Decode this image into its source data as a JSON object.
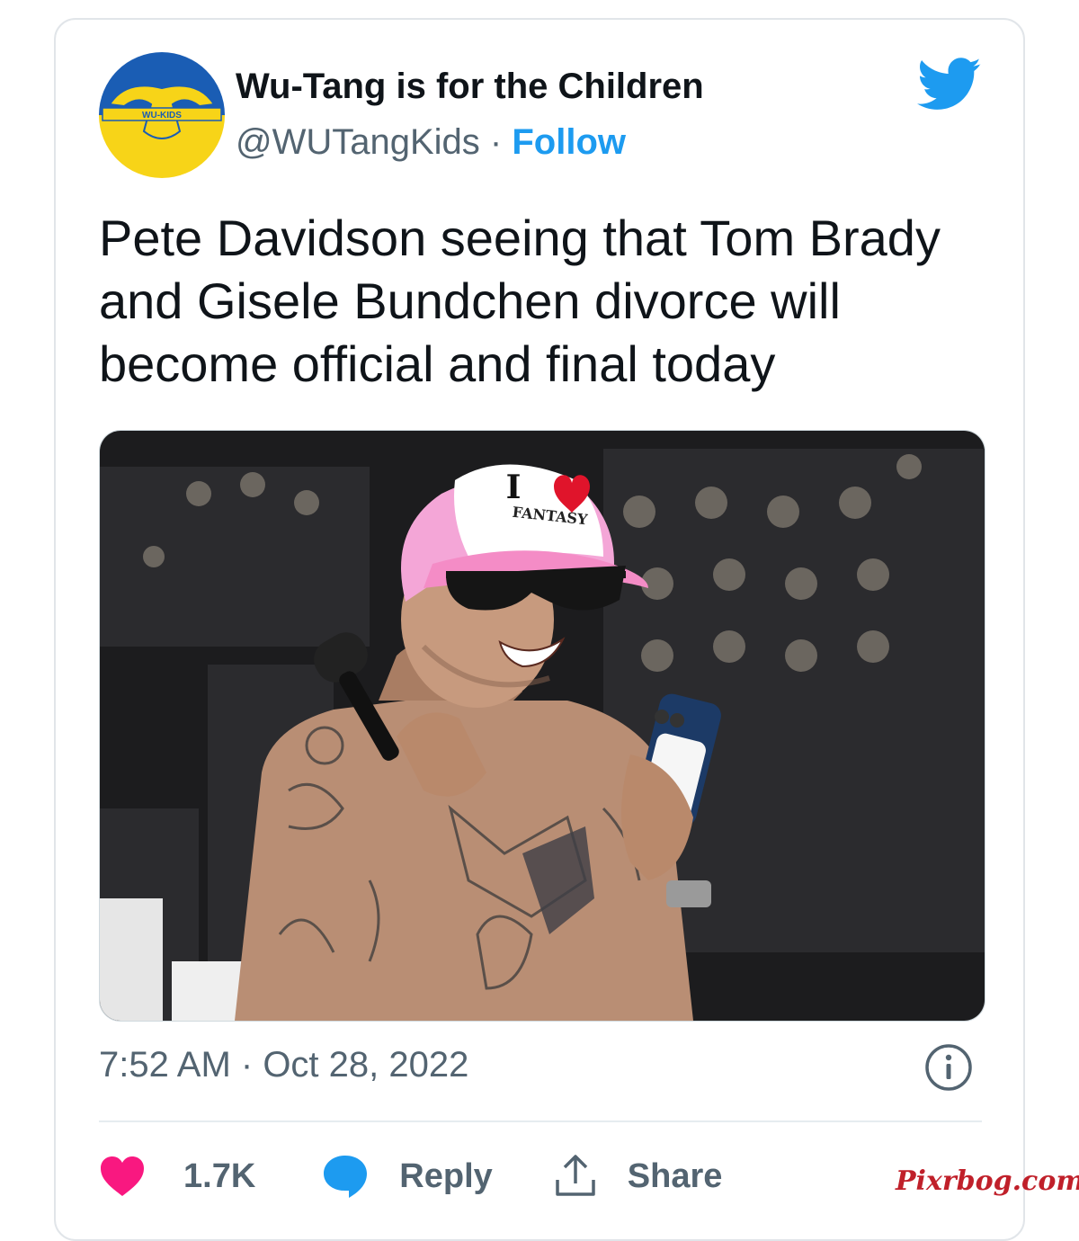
{
  "tweet": {
    "display_name": "Wu-Tang is for the Children",
    "handle": "@WUTangKids",
    "separator": " · ",
    "follow_label": "Follow",
    "text": "Pete Davidson seeing that Tom Brady and Gisele Bundchen divorce will become official and final today",
    "time": "7:52 AM",
    "date": "Oct 28, 2022",
    "likes": "1.7K",
    "reply_label": "Reply",
    "share_label": "Share",
    "avatar_logo_text": "WU-KIDS"
  },
  "media": {
    "cap_text_1": "I",
    "cap_text_2": "FANTASY"
  },
  "watermark": "Pixrbog.com",
  "colors": {
    "accent": "#1d9bf0",
    "like": "#f91880",
    "text": "#0f1419",
    "muted": "#536471",
    "avatar_blue": "#1a5db4",
    "avatar_yellow": "#f7d418"
  },
  "icons": {
    "brand": "twitter-bird-icon",
    "info": "info-icon",
    "like": "heart-icon",
    "reply": "speech-bubble-icon",
    "share": "share-upload-icon"
  }
}
